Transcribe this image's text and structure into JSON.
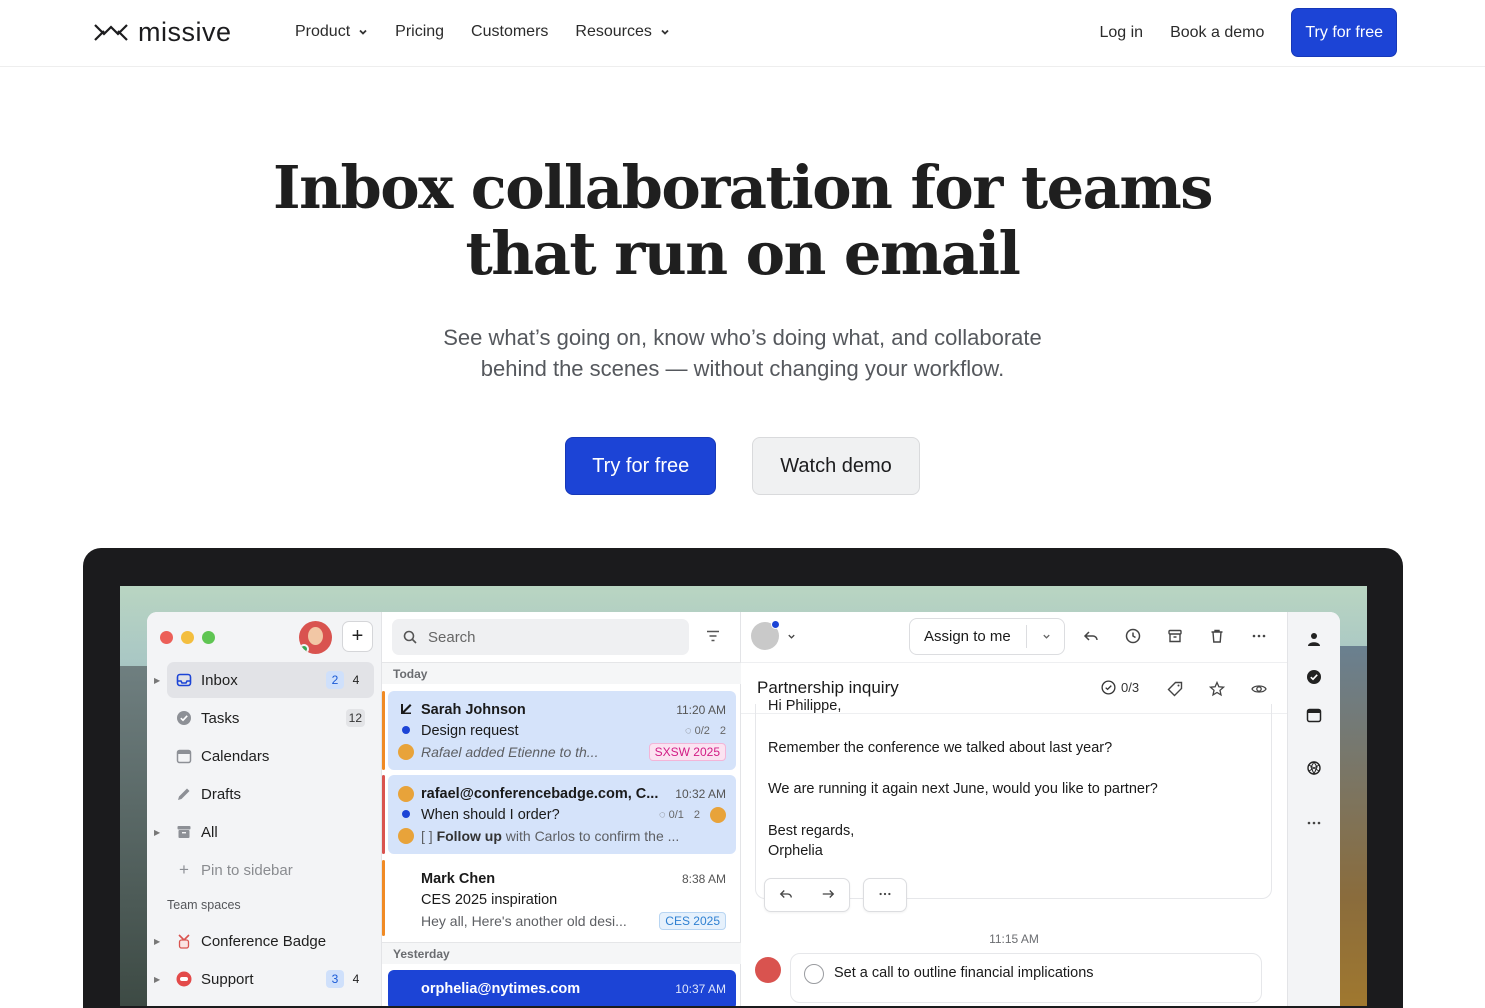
{
  "nav": {
    "logo_text": "missive",
    "links": [
      "Product",
      "Pricing",
      "Customers",
      "Resources"
    ],
    "login": "Log in",
    "demo": "Book a demo",
    "cta": "Try for free"
  },
  "hero": {
    "title_line1": "Inbox collaboration for teams",
    "title_line2": "that run on email",
    "sub_line1": "See what’s going on, know who’s doing what, and collaborate",
    "sub_line2": "behind the scenes — without changing your workflow.",
    "primary_cta": "Try for free",
    "secondary_cta": "Watch demo"
  },
  "app": {
    "sidebar": {
      "items": [
        {
          "label": "Inbox",
          "badges": [
            "2",
            "4"
          ]
        },
        {
          "label": "Tasks",
          "badges": [
            "12"
          ]
        },
        {
          "label": "Calendars"
        },
        {
          "label": "Drafts"
        },
        {
          "label": "All"
        },
        {
          "label": "Pin to sidebar"
        }
      ],
      "section_label": "Team spaces",
      "spaces": [
        {
          "label": "Conference Badge"
        },
        {
          "label": "Support",
          "badges": [
            "3",
            "4"
          ]
        }
      ]
    },
    "list": {
      "search_placeholder": "Search",
      "section_today": "Today",
      "section_yesterday": "Yesterday",
      "conversations": [
        {
          "from": "Sarah Johnson",
          "time": "11:20 AM",
          "subject": "Design request",
          "tasks": "0/2",
          "count": "2",
          "preview": "Rafael added Etienne to th...",
          "tag": "SXSW 2025"
        },
        {
          "from": "rafael@conferencebadge.com, C...",
          "time": "10:32 AM",
          "subject": "When should I order?",
          "tasks": "0/1",
          "count": "2",
          "preview_prefix": "[ ]",
          "preview_bold": "Follow up",
          "preview": "with Carlos to confirm the ..."
        },
        {
          "from": "Mark Chen",
          "time": "8:38 AM",
          "subject": "CES 2025 inspiration",
          "preview": "Hey all, Here's another old desi...",
          "tag": "CES 2025"
        },
        {
          "from": "orphelia@nytimes.com",
          "time": "10:37 AM"
        }
      ]
    },
    "detail": {
      "assign_label": "Assign to me",
      "subject": "Partnership inquiry",
      "task_count": "0/3",
      "body_greeting": "Hi Philippe,",
      "body_p1": "Remember the conference we talked about last year?",
      "body_p2": "We are running it again next June, would you like to partner?",
      "body_signoff": "Best regards,",
      "body_name": "Orphelia",
      "time": "11:15 AM",
      "task_text": "Set a call to outline financial implications"
    }
  },
  "colors": {
    "brand_blue": "#1c44d6",
    "tag_pink": "#d21c85",
    "tag_blue": "#2f80d1",
    "accent_orange": "#f08a24"
  }
}
